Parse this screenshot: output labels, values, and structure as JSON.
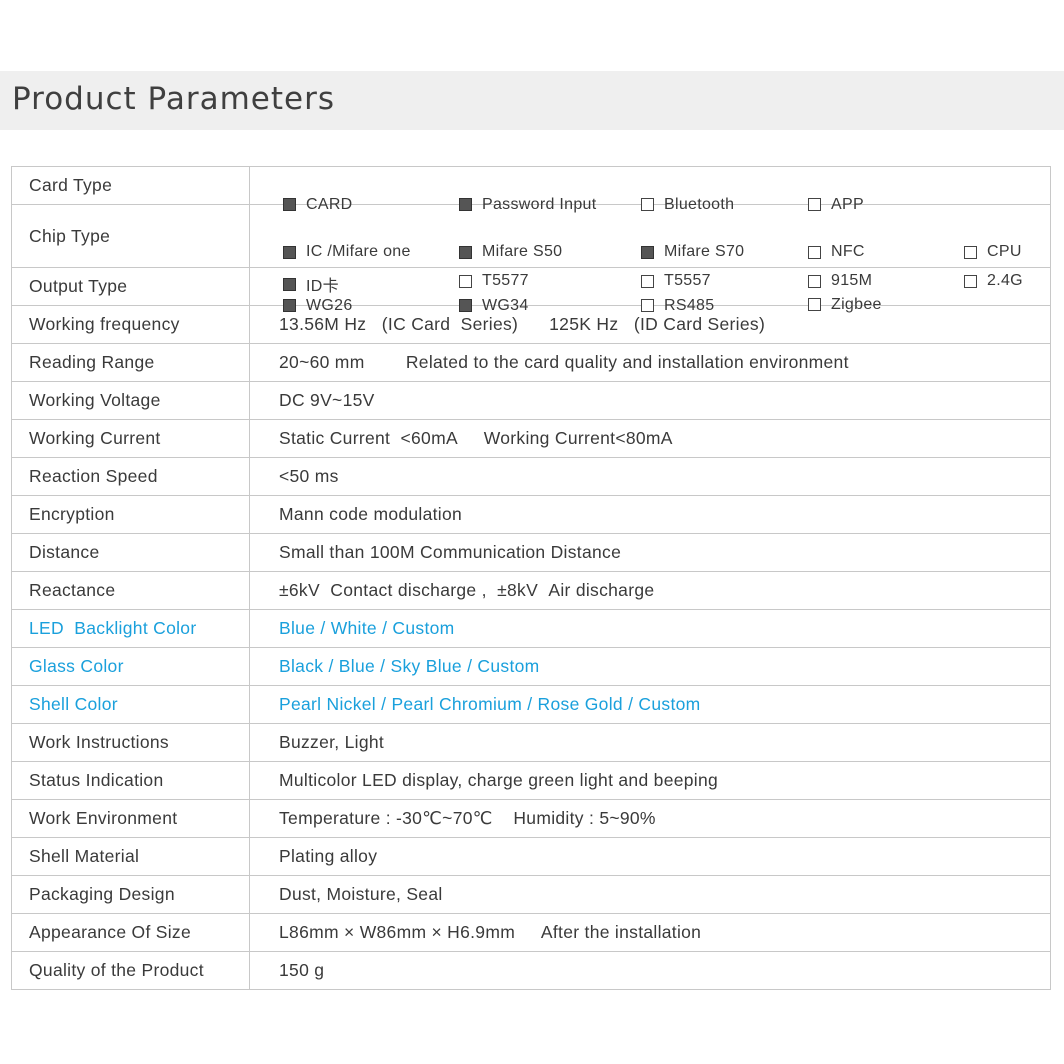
{
  "title": "Product Parameters",
  "option_rows": {
    "card_type": {
      "label": "Card Type",
      "options": [
        {
          "label": "CARD",
          "checked": true
        },
        {
          "label": "Password Input",
          "checked": true
        },
        {
          "label": "Bluetooth",
          "checked": false
        },
        {
          "label": "APP",
          "checked": false
        }
      ]
    },
    "chip_type": {
      "label": "Chip Type",
      "options": [
        {
          "label": "IC /Mifare one",
          "checked": true
        },
        {
          "label": "Mifare S50",
          "checked": true
        },
        {
          "label": "Mifare S70",
          "checked": true
        },
        {
          "label": "NFC",
          "checked": false
        },
        {
          "label": "CPU",
          "checked": false
        },
        {
          "label": "ID卡",
          "checked": true
        },
        {
          "label": "T5577",
          "checked": false
        },
        {
          "label": "T5557",
          "checked": false
        },
        {
          "label": "915M",
          "checked": false
        },
        {
          "label": "2.4G",
          "checked": false
        }
      ]
    },
    "output_type": {
      "label": "Output Type",
      "options": [
        {
          "label": "WG26",
          "checked": true
        },
        {
          "label": "WG34",
          "checked": true
        },
        {
          "label": "RS485",
          "checked": false
        },
        {
          "label": "Zigbee",
          "checked": false
        }
      ]
    }
  },
  "rows": [
    {
      "label": "Working frequency",
      "value": "13.56M Hz   (IC Card  Series)      125K Hz   (ID Card Series)"
    },
    {
      "label": "Reading Range",
      "value": "20~60 mm        Related to the card quality and installation environment"
    },
    {
      "label": "Working Voltage",
      "value": "DC 9V~15V"
    },
    {
      "label": "Working Current",
      "value": "Static Current  <60mA     Working Current<80mA"
    },
    {
      "label": "Reaction Speed",
      "value": "<50 ms"
    },
    {
      "label": "Encryption",
      "value": "Mann code modulation"
    },
    {
      "label": "Distance",
      "value": "Small than 100M Communication Distance"
    },
    {
      "label": "Reactance",
      "value": "±6kV  Contact discharge ,  ±8kV  Air discharge"
    },
    {
      "label": "LED  Backlight Color",
      "value": "Blue / White / Custom",
      "highlight": true
    },
    {
      "label": "Glass Color",
      "value": "Black / Blue / Sky Blue / Custom",
      "highlight": true
    },
    {
      "label": "Shell Color",
      "value": "Pearl Nickel / Pearl Chromium / Rose Gold / Custom",
      "highlight": true
    },
    {
      "label": "Work Instructions",
      "value": "Buzzer, Light"
    },
    {
      "label": "Status Indication",
      "value": "Multicolor LED display, charge green light and beeping"
    },
    {
      "label": "Work Environment",
      "value": "Temperature : -30℃~70℃    Humidity : 5~90%"
    },
    {
      "label": "Shell Material",
      "value": "Plating alloy"
    },
    {
      "label": "Packaging Design",
      "value": "Dust, Moisture, Seal"
    },
    {
      "label": "Appearance Of Size",
      "value": "L86mm × W86mm × H6.9mm     After the installation"
    },
    {
      "label": "Quality of the Product",
      "value": "150 g"
    }
  ],
  "colors": {
    "highlight": "#1aa0dc",
    "banner": "#efefef",
    "border": "#c8c8c8",
    "checked_box": "#555555"
  }
}
